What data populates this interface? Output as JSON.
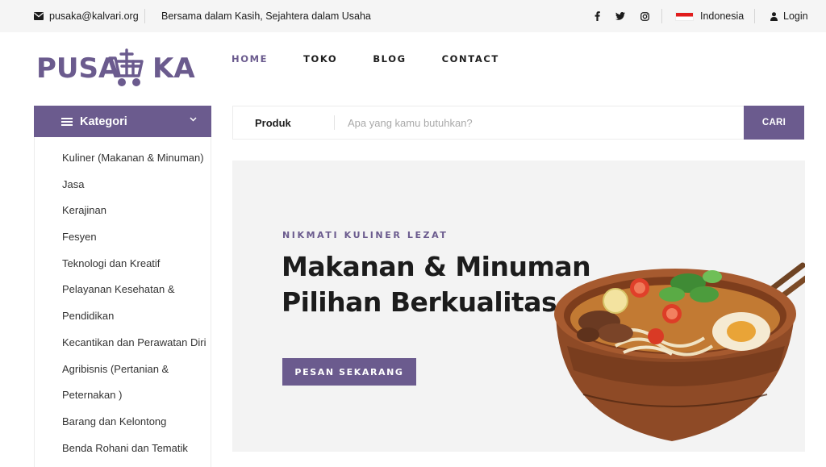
{
  "topbar": {
    "email": "pusaka@kalvari.org",
    "tagline": "Bersama dalam Kasih, Sejahtera dalam Usaha",
    "social_icons": [
      "facebook-icon",
      "twitter-icon",
      "instagram-icon"
    ],
    "language": "Indonesia",
    "login_label": "Login"
  },
  "logo": {
    "text_left": "PUSA",
    "text_right": "KA",
    "icon": "cart-cross-icon"
  },
  "nav": {
    "items": [
      {
        "label": "HOME",
        "active": true
      },
      {
        "label": "TOKO",
        "active": false
      },
      {
        "label": "BLOG",
        "active": false
      },
      {
        "label": "CONTACT",
        "active": false
      }
    ]
  },
  "categories": {
    "title": "Kategori",
    "items": [
      "Kuliner (Makanan & Minuman)",
      "Jasa",
      "Kerajinan",
      "Fesyen",
      "Teknologi dan Kreatif",
      "Pelayanan Kesehatan &",
      "Pendidikan",
      "Kecantikan dan Perawatan Diri",
      "Agribisnis (Pertanian &",
      "Peternakan )",
      "Barang dan Kelontong",
      "Benda Rohani dan Tematik"
    ]
  },
  "search": {
    "category_label": "Produk",
    "placeholder": "Apa yang kamu butuhkan?",
    "button_label": "CARI"
  },
  "hero": {
    "eyebrow": "NIKMATI KULINER LEZAT",
    "title_line1": "Makanan & Minuman",
    "title_line2": "Pilihan Berkualitas",
    "cta_label": "PESAN SEKARANG"
  },
  "colors": {
    "brand": "#6b5b8e",
    "topbar_bg": "#f5f5f5",
    "hero_bg": "#f3f3f3",
    "flag_red": "#e11d1d"
  }
}
